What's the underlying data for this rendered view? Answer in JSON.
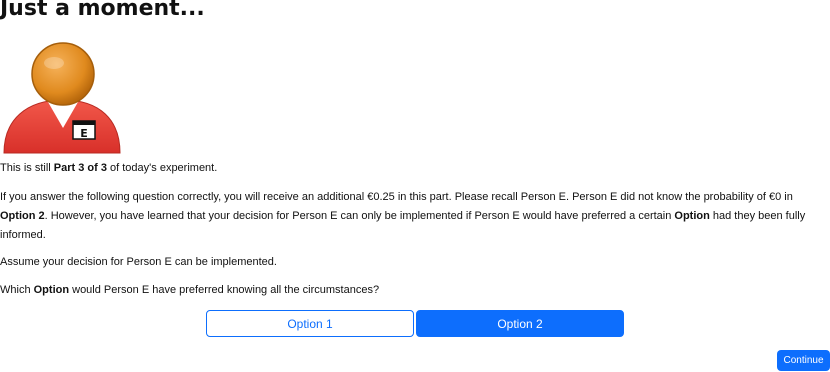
{
  "page": {
    "title": "Just a moment..."
  },
  "avatar": {
    "badge_letter": "E"
  },
  "intro": {
    "prefix": "This is still ",
    "part_bold": "Part 3 of 3",
    "suffix": " of today's experiment."
  },
  "info": {
    "text1": "If you answer the following question correctly, you will receive an additional €0.25 in this part. Please recall Person E. Person E did not know the probability of €0 in ",
    "bold1": "Option 2",
    "text2": ". However, you have learned that your decision for Person E can only be implemented if Person E would have preferred a certain ",
    "bold2": "Option",
    "text3": " had they been fully informed."
  },
  "assume": {
    "text": "Assume your decision for Person E can be implemented."
  },
  "question": {
    "prefix": "Which ",
    "bold": "Option",
    "suffix": " would Person E have preferred knowing all the circumstances?"
  },
  "options": [
    {
      "label": "Option 1",
      "selected": false
    },
    {
      "label": "Option 2",
      "selected": true
    }
  ],
  "continue_label": "Continue",
  "colors": {
    "primary": "#0d6efd",
    "avatar_head": "#e08a1e",
    "avatar_body": "#e63b2e"
  }
}
